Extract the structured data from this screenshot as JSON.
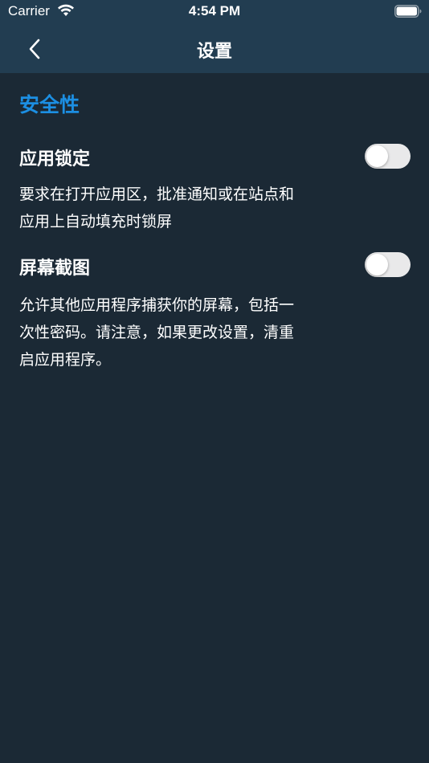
{
  "status_bar": {
    "carrier": "Carrier",
    "time": "4:54 PM"
  },
  "nav": {
    "title": "设置",
    "back_icon": "chevron-left-icon"
  },
  "section": {
    "title": "安全性"
  },
  "settings": [
    {
      "title": "应用锁定",
      "description": "要求在打开应用区，批准通知或在站点和应用上自动填充时锁屏",
      "enabled": false
    },
    {
      "title": "屏幕截图",
      "description": "允许其他应用程序捕获你的屏幕，包括一次性密码。请注意，如果更改设置，清重启应用程序。",
      "enabled": false
    }
  ],
  "colors": {
    "header_bg": "#223d51",
    "page_bg": "#1b2935",
    "accent": "#1c8fe3",
    "toggle_off": "#e9e9ea"
  }
}
